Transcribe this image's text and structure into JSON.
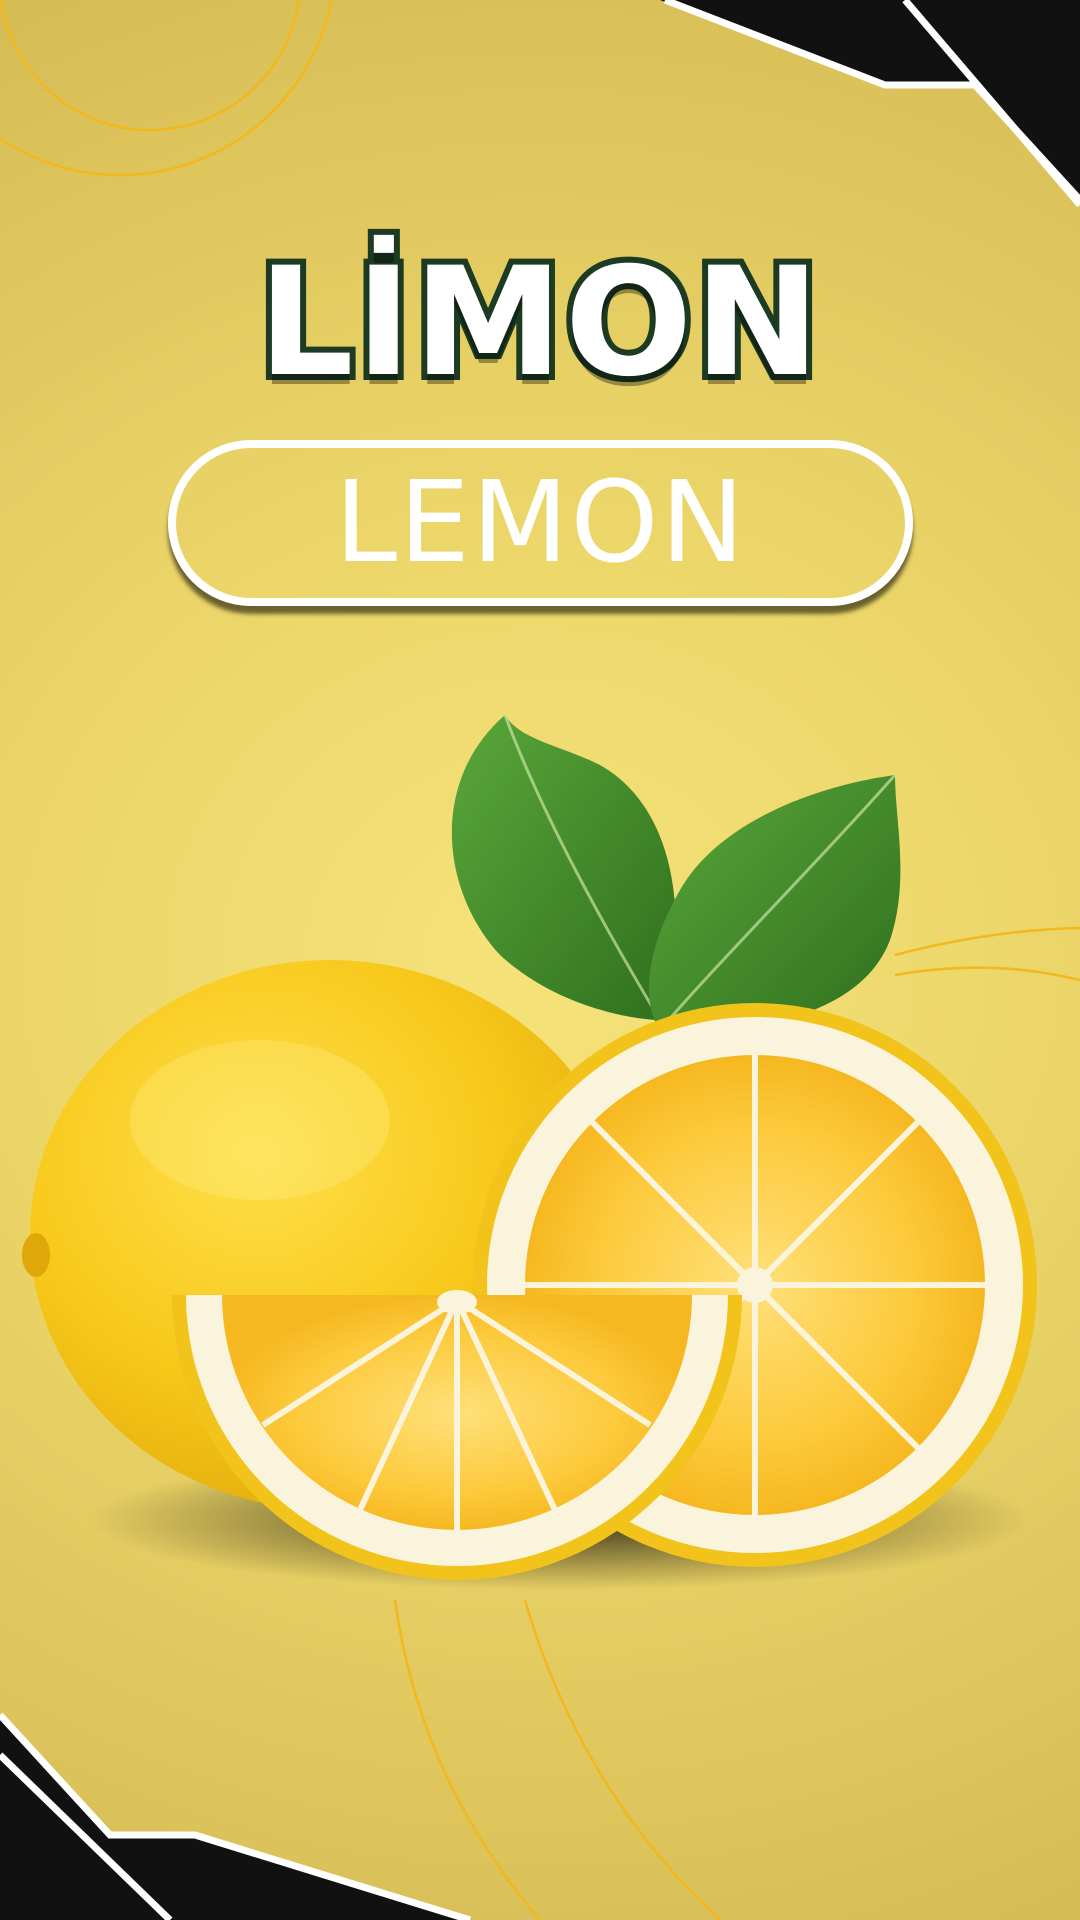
{
  "title": {
    "main": "LİMON",
    "translation": "LEMON"
  },
  "colors": {
    "background": "#ebd568",
    "title_outline": "#1d3b22",
    "corner_black": "#111111",
    "lemon_yellow": "#f7c81a",
    "leaf_green": "#3f8f2a"
  },
  "image": {
    "subject": "lemon-with-slices-and-leaves-illustration"
  }
}
